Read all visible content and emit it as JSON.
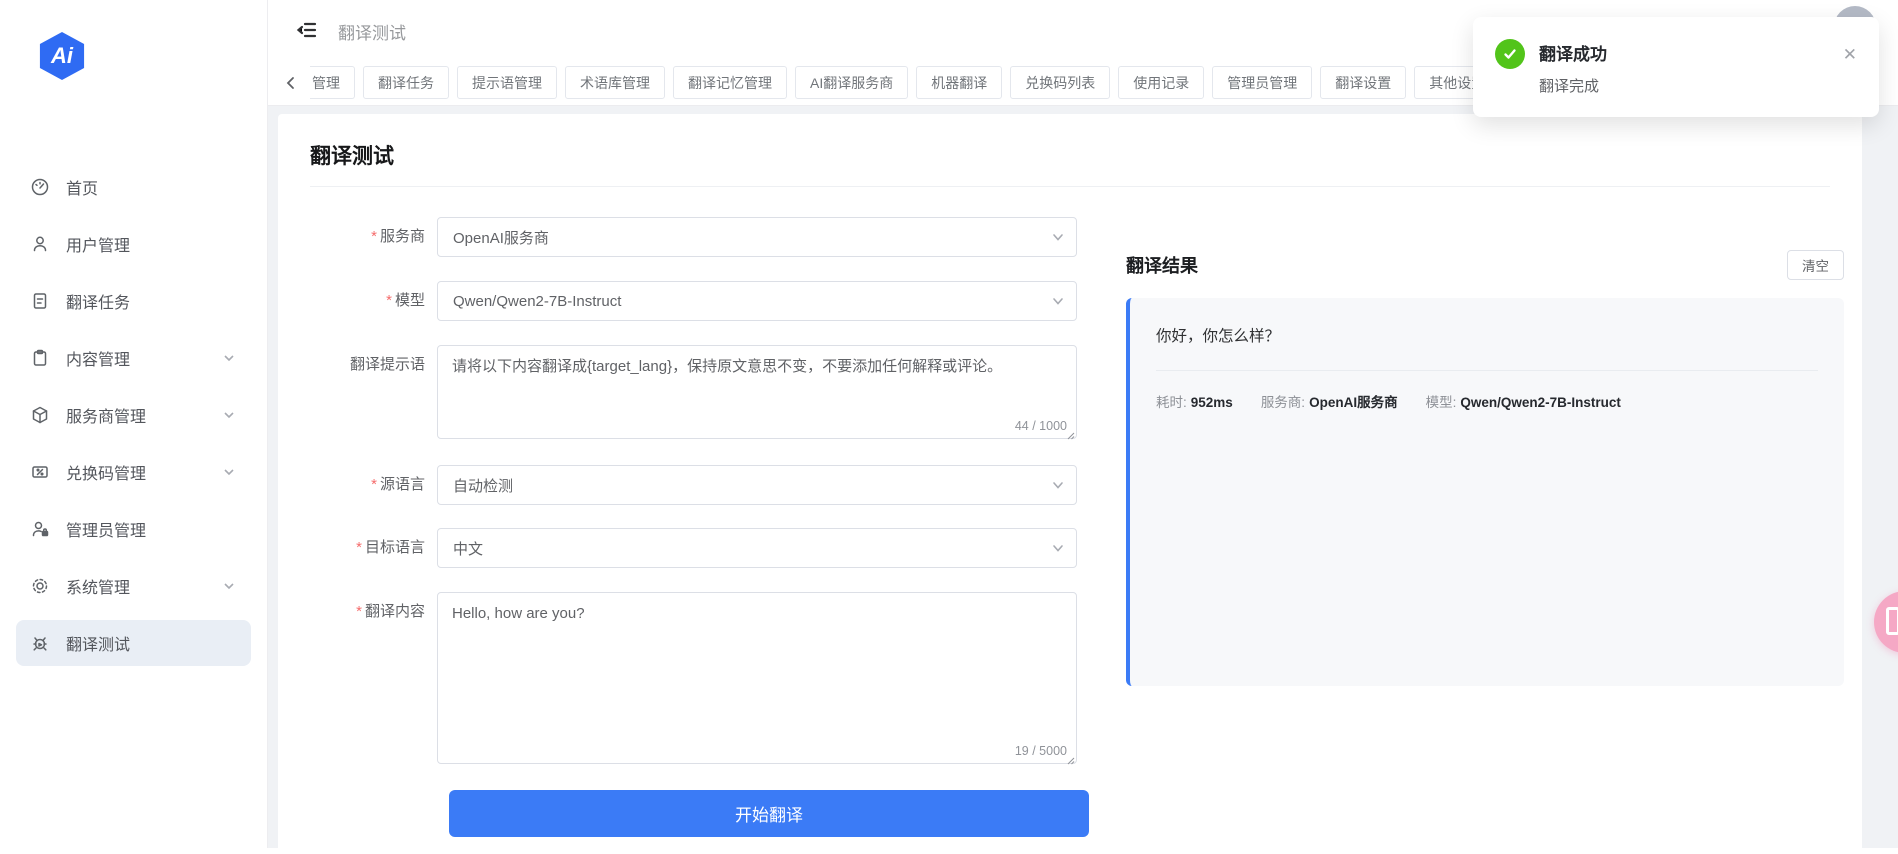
{
  "app": {
    "logo_text": "Ai"
  },
  "colors": {
    "primary": "#3b7bf6",
    "success": "#52c41a",
    "logo_blue": "#2f6bf3",
    "sidebar_active_bg": "#e9eef5",
    "floating_button_pink": "#f5a8c5"
  },
  "sidebar": {
    "items": [
      {
        "label": "首页",
        "icon": "dashboard-icon",
        "expandable": false,
        "active": false
      },
      {
        "label": "用户管理",
        "icon": "user-icon",
        "expandable": false,
        "active": false
      },
      {
        "label": "翻译任务",
        "icon": "document-icon",
        "expandable": false,
        "active": false
      },
      {
        "label": "内容管理",
        "icon": "clipboard-icon",
        "expandable": true,
        "active": false
      },
      {
        "label": "服务商管理",
        "icon": "package-icon",
        "expandable": true,
        "active": false
      },
      {
        "label": "兑换码管理",
        "icon": "ticket-icon",
        "expandable": true,
        "active": false
      },
      {
        "label": "管理员管理",
        "icon": "admin-lock-icon",
        "expandable": false,
        "active": false
      },
      {
        "label": "系统管理",
        "icon": "gear-icon",
        "expandable": true,
        "active": false
      },
      {
        "label": "翻译测试",
        "icon": "bug-icon",
        "expandable": false,
        "active": true
      }
    ]
  },
  "header": {
    "breadcrumb": "翻译测试",
    "more_icon": "⋯"
  },
  "tabs": {
    "items": [
      {
        "label": "管理"
      },
      {
        "label": "翻译任务"
      },
      {
        "label": "提示语管理"
      },
      {
        "label": "术语库管理"
      },
      {
        "label": "翻译记忆管理"
      },
      {
        "label": "AI翻译服务商"
      },
      {
        "label": "机器翻译"
      },
      {
        "label": "兑换码列表"
      },
      {
        "label": "使用记录"
      },
      {
        "label": "管理员管理"
      },
      {
        "label": "翻译设置"
      },
      {
        "label": "其他设置"
      }
    ]
  },
  "page": {
    "title": "翻译测试"
  },
  "form": {
    "required_mark": "*",
    "provider": {
      "label": "服务商",
      "value": "OpenAI服务商"
    },
    "model": {
      "label": "模型",
      "value": "Qwen/Qwen2-7B-Instruct"
    },
    "prompt": {
      "label": "翻译提示语",
      "value": "请将以下内容翻译成{target_lang}，保持原文意思不变，不要添加任何解释或评论。",
      "counter": "44 / 1000"
    },
    "source_lang": {
      "label": "源语言",
      "value": "自动检测"
    },
    "target_lang": {
      "label": "目标语言",
      "value": "中文"
    },
    "content": {
      "label": "翻译内容",
      "value": "Hello, how are you?",
      "counter": "19 / 5000"
    },
    "submit_label": "开始翻译"
  },
  "result": {
    "title": "翻译结果",
    "clear_label": "清空",
    "text": "你好，你怎么样？",
    "time_label": "耗时:",
    "time_value": "952ms",
    "provider_label": "服务商:",
    "provider_value": "OpenAI服务商",
    "model_label": "模型:",
    "model_value": "Qwen/Qwen2-7B-Instruct"
  },
  "toast": {
    "title": "翻译成功",
    "message": "翻译完成",
    "close_glyph": "✕"
  }
}
